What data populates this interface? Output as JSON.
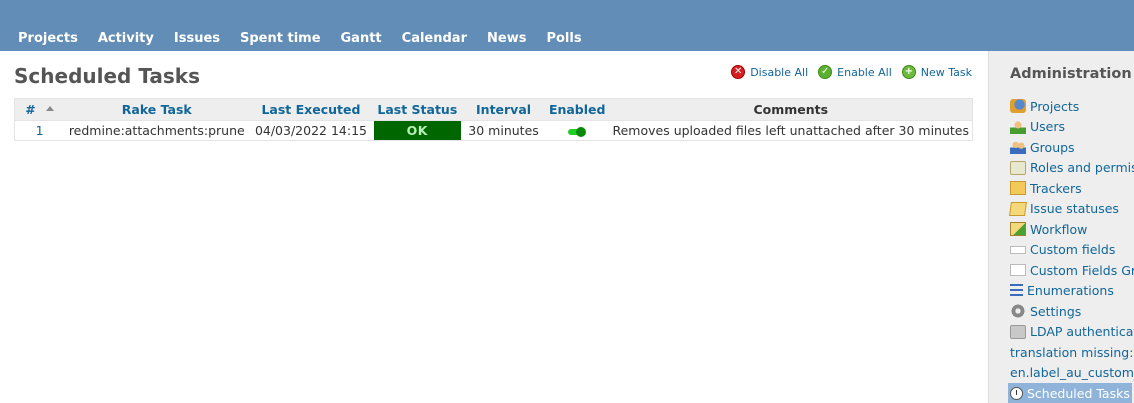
{
  "nav": {
    "tabs": [
      "Projects",
      "Activity",
      "Issues",
      "Spent time",
      "Gantt",
      "Calendar",
      "News",
      "Polls"
    ]
  },
  "page": {
    "title": "Scheduled Tasks",
    "actions": {
      "disable_all": "Disable All",
      "enable_all": "Enable All",
      "new_task": "New Task"
    }
  },
  "table": {
    "headers": {
      "id": "#",
      "rake_task": "Rake Task",
      "last_executed": "Last Executed",
      "last_status": "Last Status",
      "interval": "Interval",
      "enabled": "Enabled",
      "comments": "Comments"
    },
    "rows": [
      {
        "id": "1",
        "rake_task": "redmine:attachments:prune",
        "last_executed": "04/03/2022 14:15",
        "last_status": "OK",
        "interval": "30 minutes",
        "enabled": true,
        "comments": "Removes uploaded files left unattached after 30 minutes"
      }
    ]
  },
  "sidebar": {
    "title": "Administration",
    "items": [
      {
        "label": "Projects",
        "icon": "projects-icon"
      },
      {
        "label": "Users",
        "icon": "user-icon"
      },
      {
        "label": "Groups",
        "icon": "group-icon"
      },
      {
        "label": "Roles and permis",
        "icon": "roles-icon"
      },
      {
        "label": "Trackers",
        "icon": "tracker-icon"
      },
      {
        "label": "Issue statuses",
        "icon": "issue-status-icon"
      },
      {
        "label": "Workflow",
        "icon": "workflow-icon"
      },
      {
        "label": "Custom fields",
        "icon": "custom-field-icon"
      },
      {
        "label": "Custom Fields Gro",
        "icon": "custom-field-group-icon"
      },
      {
        "label": "Enumerations",
        "icon": "list-icon"
      },
      {
        "label": "Settings",
        "icon": "gear-icon"
      },
      {
        "label": "LDAP authenticat",
        "icon": "server-key-icon"
      },
      {
        "label": "translation missing:",
        "icon": ""
      },
      {
        "label": "en.label_au_custom_",
        "icon": ""
      },
      {
        "label": "Scheduled Tasks",
        "icon": "clock-icon",
        "selected": true
      }
    ]
  },
  "colors": {
    "header_bg": "#628db6",
    "link": "#116699",
    "status_ok_bg": "#006600",
    "sidebar_bg": "#eeeeee",
    "selected_bg": "#90b4d9"
  }
}
